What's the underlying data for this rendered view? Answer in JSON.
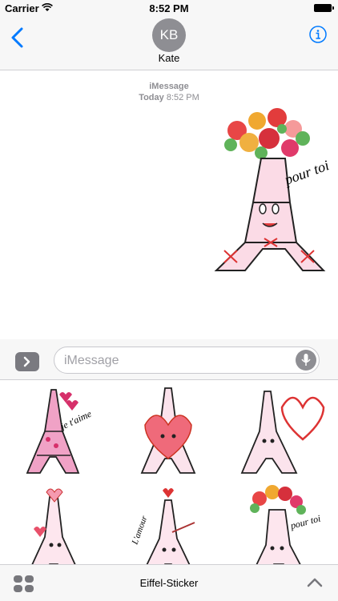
{
  "status_bar": {
    "carrier": "Carrier",
    "time": "8:52 PM"
  },
  "nav": {
    "avatar_initials": "KB",
    "contact_name": "Kate"
  },
  "thread": {
    "service_label": "iMessage",
    "timestamp_day": "Today",
    "timestamp_time": "8:52 PM"
  },
  "input": {
    "placeholder": "iMessage"
  },
  "app_bar": {
    "app_name": "Eiffel-Sticker"
  },
  "stickers": {
    "sent": {
      "caption": "pour toi"
    },
    "drawer": [
      {
        "icon": "eiffel-hearts-sticker",
        "caption": "je t'aime"
      },
      {
        "icon": "eiffel-big-heart-sticker",
        "caption": ""
      },
      {
        "icon": "eiffel-heart-balloon-sticker",
        "caption": ""
      },
      {
        "icon": "eiffel-hearts-tree-sticker",
        "caption": ""
      },
      {
        "icon": "eiffel-lamour-sticker",
        "caption": "L'amour"
      },
      {
        "icon": "eiffel-flowers-sticker",
        "caption": "pour toi"
      }
    ]
  },
  "colors": {
    "accent": "#007aff",
    "gray": "#8e8e93",
    "pink": "#f08fb8",
    "red": "#e03a3a"
  }
}
